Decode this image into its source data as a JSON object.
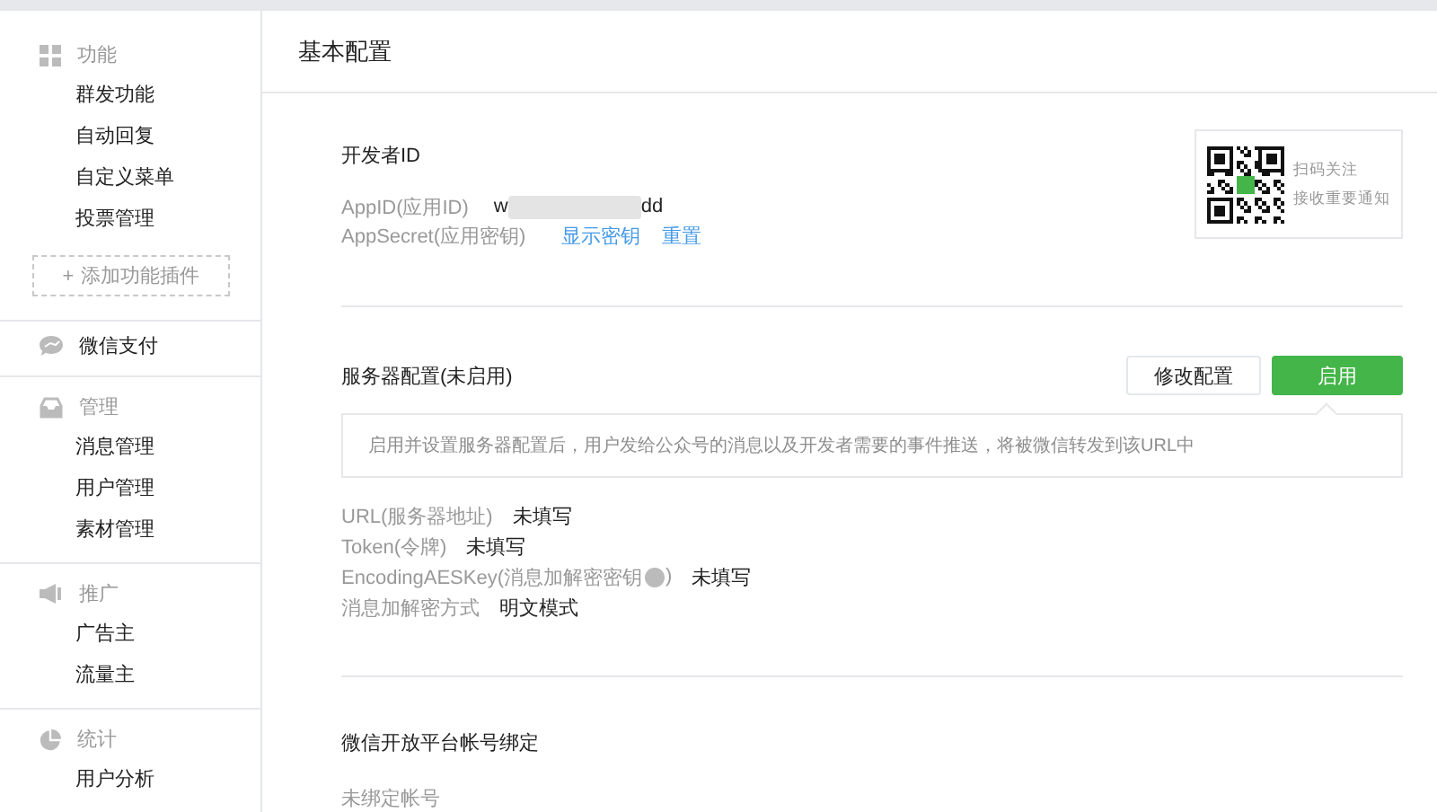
{
  "sidebar": {
    "sections": [
      {
        "kind": "group",
        "title": "功能",
        "items": [
          "群发功能",
          "自动回复",
          "自定义菜单",
          "投票管理"
        ],
        "add_button_sign": "+",
        "add_button": "添加功能插件"
      },
      {
        "kind": "link",
        "title": "微信支付"
      },
      {
        "kind": "group",
        "title": "管理",
        "items": [
          "消息管理",
          "用户管理",
          "素材管理"
        ]
      },
      {
        "kind": "group",
        "title": "推广",
        "items": [
          "广告主",
          "流量主"
        ]
      },
      {
        "kind": "group",
        "title": "统计",
        "items": [
          "用户分析"
        ]
      }
    ]
  },
  "page_title": "基本配置",
  "developer": {
    "title": "开发者ID",
    "app_id_label": "AppID(应用ID)",
    "app_id_start": "w",
    "app_id_end": "dd",
    "secret_label": "AppSecret(应用密钥)",
    "links": [
      "显示密钥",
      "重置"
    ],
    "qr": {
      "lines": [
        "扫码关注",
        "接收重要通知"
      ]
    }
  },
  "server": {
    "title": "服务器配置(未启用)",
    "buttons": [
      {
        "label": "修改配置",
        "kind": "default"
      },
      {
        "label": "启用",
        "kind": "primary"
      }
    ],
    "notice": "启用并设置服务器配置后，用户发给公众号的消息以及开发者需要的事件推送，将被微信转发到该URL中",
    "fields": [
      {
        "label": "URL(服务器地址)",
        "value": "未填写",
        "help": false
      },
      {
        "label": "Token(令牌)",
        "value": "未填写",
        "help": false
      },
      {
        "label": "EncodingAESKey(消息加解密密钥",
        "label_end": ")",
        "value": "未填写",
        "help": true
      },
      {
        "label": "消息加解密方式",
        "value": "明文模式",
        "help": false
      }
    ]
  },
  "open_platform": {
    "title": "微信开放平台帐号绑定",
    "status": "未绑定帐号"
  }
}
